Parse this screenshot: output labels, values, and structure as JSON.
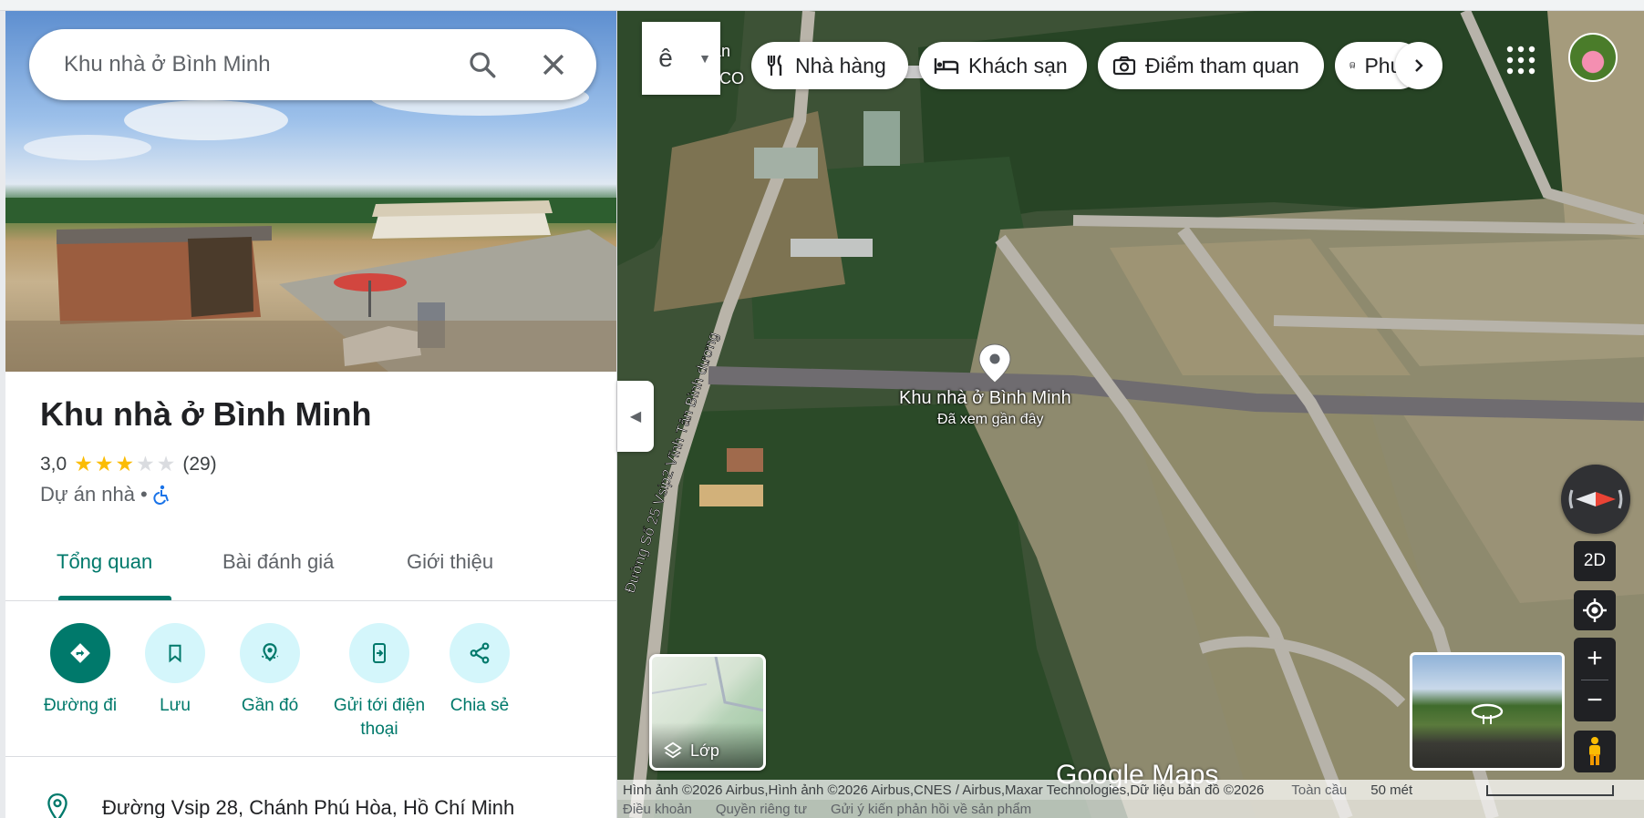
{
  "search": {
    "value": "Khu nhà ở Bình Minh"
  },
  "place": {
    "title": "Khu nhà ở Bình Minh",
    "rating": "3,0",
    "stars_filled": 3,
    "stars_total": 5,
    "review_count": "(29)",
    "category": "Dự án nhà",
    "category_sep": "•",
    "address": "Đường Vsip 28, Chánh Phú Hòa, Hồ Chí Minh"
  },
  "tabs": [
    {
      "label": "Tổng quan",
      "active": true
    },
    {
      "label": "Bài đánh giá",
      "active": false
    },
    {
      "label": "Giới thiệu",
      "active": false
    }
  ],
  "actions": [
    {
      "label": "Đường đi",
      "icon": "directions-icon"
    },
    {
      "label": "Lưu",
      "icon": "bookmark-icon"
    },
    {
      "label": "Gần đó",
      "icon": "nearby-icon"
    },
    {
      "label": "Gửi tới điện thoại",
      "icon": "send-to-phone-icon"
    },
    {
      "label": "Chia sẻ",
      "icon": "share-icon"
    }
  ],
  "map": {
    "transit_glyph": "ê",
    "chips": [
      {
        "label": "Nhà hàng",
        "icon": "restaurant-icon"
      },
      {
        "label": "Khách sạn",
        "icon": "hotel-icon"
      },
      {
        "label": "Điểm tham quan",
        "icon": "camera-icon"
      },
      {
        "label": "Phư",
        "icon": "train-icon"
      }
    ],
    "pin_label": "Khu nhà ở Bình Minh",
    "pin_sublabel": "Đã xem gần đây",
    "road_label": "Đường Số 25 Vsip2 Vĩnh Tân Bình dương",
    "corner_label_1": "uán",
    "corner_label_2": "U CO",
    "layers_label": "Lớp",
    "view_mode": "2D",
    "logo": "Google Maps",
    "attribution": "Hình ảnh ©2026 Airbus,Hình ảnh ©2026 Airbus,CNES / Airbus,Maxar Technologies,Dữ liệu bản đồ ©2026",
    "global": "Toàn cầu",
    "scale": "50 mét",
    "footer_links": [
      "Điều khoản",
      "Quyền riêng tư",
      "Gửi ý kiến phản hồi về sản phẩm"
    ]
  },
  "colors": {
    "accent": "#00796b",
    "action_bg": "#d4f6fb",
    "star": "#fbbc04",
    "link": "#1a73e8"
  }
}
